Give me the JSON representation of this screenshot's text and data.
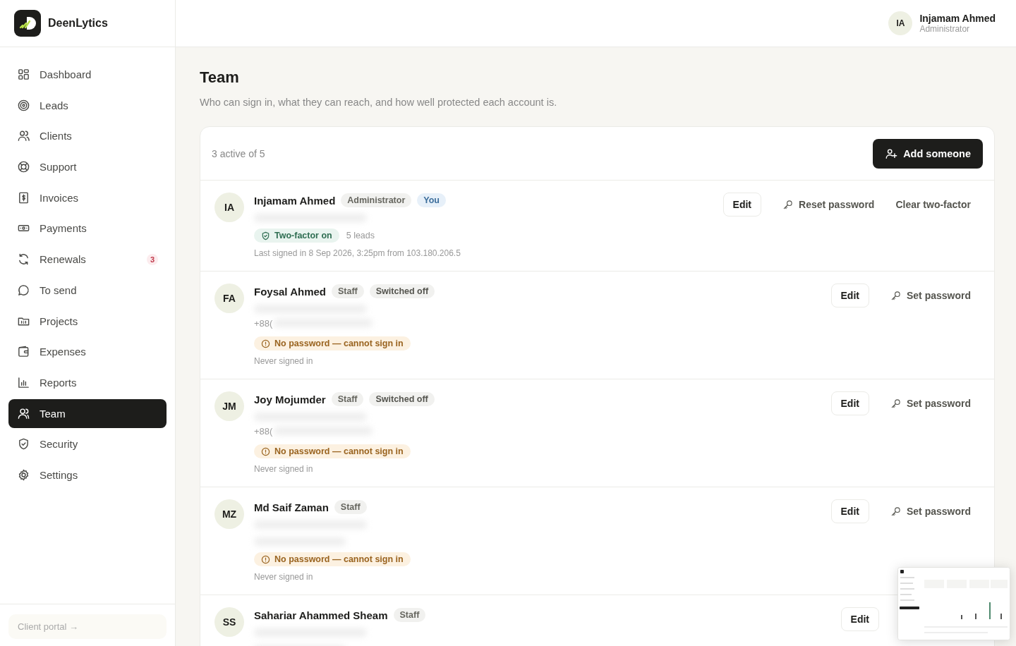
{
  "brand": {
    "name": "DeenLytics"
  },
  "sidebar": {
    "items": [
      {
        "label": "Dashboard",
        "selected": false
      },
      {
        "label": "Leads",
        "selected": false
      },
      {
        "label": "Clients",
        "selected": false
      },
      {
        "label": "Support",
        "selected": false
      },
      {
        "label": "Invoices",
        "selected": false
      },
      {
        "label": "Payments",
        "selected": false
      },
      {
        "label": "Renewals",
        "selected": false,
        "badge": "3"
      },
      {
        "label": "To send",
        "selected": false
      },
      {
        "label": "Projects",
        "selected": false
      },
      {
        "label": "Expenses",
        "selected": false
      },
      {
        "label": "Reports",
        "selected": false
      },
      {
        "label": "Team",
        "selected": true
      },
      {
        "label": "Security",
        "selected": false
      },
      {
        "label": "Settings",
        "selected": false
      }
    ],
    "footer_link": "Client portal →"
  },
  "user": {
    "initials": "IA",
    "name": "Injamam Ahmed",
    "role": "Administrator"
  },
  "page": {
    "title": "Team",
    "subtitle": "Who can sign in, what they can reach, and how well protected each account is."
  },
  "team": {
    "summary": "3 active of 5",
    "add_button": "Add someone",
    "members": [
      {
        "initials": "IA",
        "name": "Injamam Ahmed",
        "tags": [
          {
            "label": "Administrator",
            "kind": "role"
          },
          {
            "label": "You",
            "kind": "you"
          }
        ],
        "status": {
          "label": "Two-factor on",
          "kind": "ok"
        },
        "leads": "5 leads",
        "last_signed": "Last signed in 8 Sep 2026, 3:25pm from 103.180.206.5",
        "actions": [
          {
            "label": "Edit",
            "kind": "button"
          },
          {
            "label": "Reset password",
            "kind": "key"
          },
          {
            "label": "Clear two-factor",
            "kind": "text"
          }
        ]
      },
      {
        "initials": "FA",
        "name": "Foysal Ahmed",
        "tags": [
          {
            "label": "Staff",
            "kind": "role"
          },
          {
            "label": "Switched off",
            "kind": "off"
          }
        ],
        "phone": "+88(",
        "status": {
          "label": "No password — cannot sign in",
          "kind": "warn"
        },
        "last_signed": "Never signed in",
        "actions": [
          {
            "label": "Edit",
            "kind": "button"
          },
          {
            "label": "Set password",
            "kind": "key"
          }
        ]
      },
      {
        "initials": "JM",
        "name": "Joy Mojumder",
        "tags": [
          {
            "label": "Staff",
            "kind": "role"
          },
          {
            "label": "Switched off",
            "kind": "off"
          }
        ],
        "phone": "+88(",
        "status": {
          "label": "No password — cannot sign in",
          "kind": "warn"
        },
        "last_signed": "Never signed in",
        "actions": [
          {
            "label": "Edit",
            "kind": "button"
          },
          {
            "label": "Set password",
            "kind": "key"
          }
        ]
      },
      {
        "initials": "MZ",
        "name": "Md Saif Zaman",
        "tags": [
          {
            "label": "Staff",
            "kind": "role"
          }
        ],
        "status": {
          "label": "No password — cannot sign in",
          "kind": "warn"
        },
        "last_signed": "Never signed in",
        "actions": [
          {
            "label": "Edit",
            "kind": "button"
          },
          {
            "label": "Set password",
            "kind": "key"
          }
        ]
      },
      {
        "initials": "SS",
        "name": "Sahariar Ahammed Sheam",
        "tags": [
          {
            "label": "Staff",
            "kind": "role"
          }
        ],
        "actions": [
          {
            "label": "Edit",
            "kind": "button"
          }
        ]
      }
    ]
  }
}
